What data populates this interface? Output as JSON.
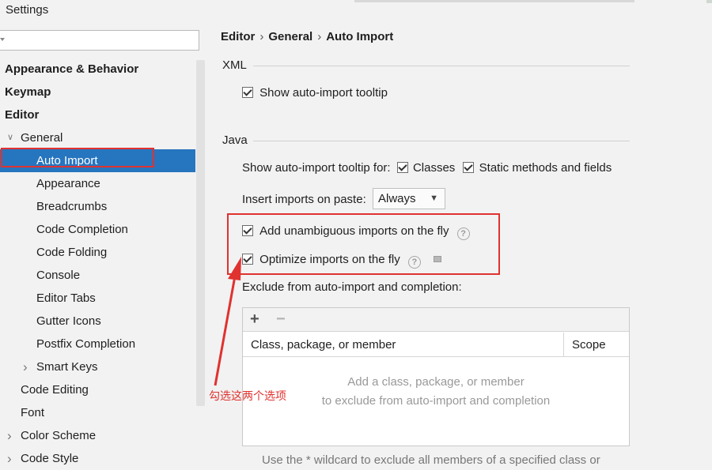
{
  "window": {
    "title": "Settings"
  },
  "sidebar": {
    "search": {
      "value": "",
      "placeholder": ""
    },
    "items": [
      {
        "label": "Appearance & Behavior",
        "level": 0,
        "bold": true,
        "arrow": ""
      },
      {
        "label": "Keymap",
        "level": 0,
        "bold": true,
        "arrow": ""
      },
      {
        "label": "Editor",
        "level": 0,
        "bold": true,
        "arrow": ""
      },
      {
        "label": "General",
        "level": 1,
        "bold": false,
        "arrow": "expanded"
      },
      {
        "label": "Auto Import",
        "level": 2,
        "bold": false,
        "arrow": "",
        "selected": true
      },
      {
        "label": "Appearance",
        "level": 2,
        "bold": false,
        "arrow": ""
      },
      {
        "label": "Breadcrumbs",
        "level": 2,
        "bold": false,
        "arrow": ""
      },
      {
        "label": "Code Completion",
        "level": 2,
        "bold": false,
        "arrow": ""
      },
      {
        "label": "Code Folding",
        "level": 2,
        "bold": false,
        "arrow": ""
      },
      {
        "label": "Console",
        "level": 2,
        "bold": false,
        "arrow": ""
      },
      {
        "label": "Editor Tabs",
        "level": 2,
        "bold": false,
        "arrow": ""
      },
      {
        "label": "Gutter Icons",
        "level": 2,
        "bold": false,
        "arrow": ""
      },
      {
        "label": "Postfix Completion",
        "level": 2,
        "bold": false,
        "arrow": ""
      },
      {
        "label": "Smart Keys",
        "level": 2,
        "bold": false,
        "arrow": "collapsed"
      },
      {
        "label": "Code Editing",
        "level": 1,
        "bold": false,
        "arrow": ""
      },
      {
        "label": "Font",
        "level": 1,
        "bold": false,
        "arrow": ""
      },
      {
        "label": "Color Scheme",
        "level": 1,
        "bold": false,
        "arrow": "collapsed"
      },
      {
        "label": "Code Style",
        "level": 1,
        "bold": false,
        "arrow": "collapsed"
      }
    ]
  },
  "breadcrumb": {
    "parts": [
      "Editor",
      "General",
      "Auto Import"
    ],
    "separator": "›"
  },
  "xml_section": {
    "title": "XML",
    "show_tooltip": {
      "label": "Show auto-import tooltip",
      "checked": true
    }
  },
  "java_section": {
    "title": "Java",
    "tooltip_for_label": "Show auto-import tooltip for:",
    "classes": {
      "label": "Classes",
      "checked": true
    },
    "static_members": {
      "label": "Static methods and fields",
      "checked": true
    },
    "insert_on_paste": {
      "label": "Insert imports on paste:",
      "value": "Always"
    },
    "add_unambiguous": {
      "label": "Add unambiguous imports on the fly",
      "checked": true
    },
    "optimize_imports": {
      "label": "Optimize imports on the fly",
      "checked": true
    },
    "help_glyph": "?"
  },
  "exclude": {
    "label": "Exclude from auto-import and completion:",
    "add_glyph": "+",
    "remove_glyph": "−",
    "columns": [
      "Class, package, or member",
      "Scope"
    ],
    "empty_line1": "Add a class, package, or member",
    "empty_line2": "to exclude from auto-import and completion",
    "footer": "Use the * wildcard to exclude all members of a specified class or"
  },
  "annotation": {
    "text": "勾选这两个选项"
  },
  "colors": {
    "selection": "#2675bf",
    "highlight_red": "#e0322f"
  }
}
